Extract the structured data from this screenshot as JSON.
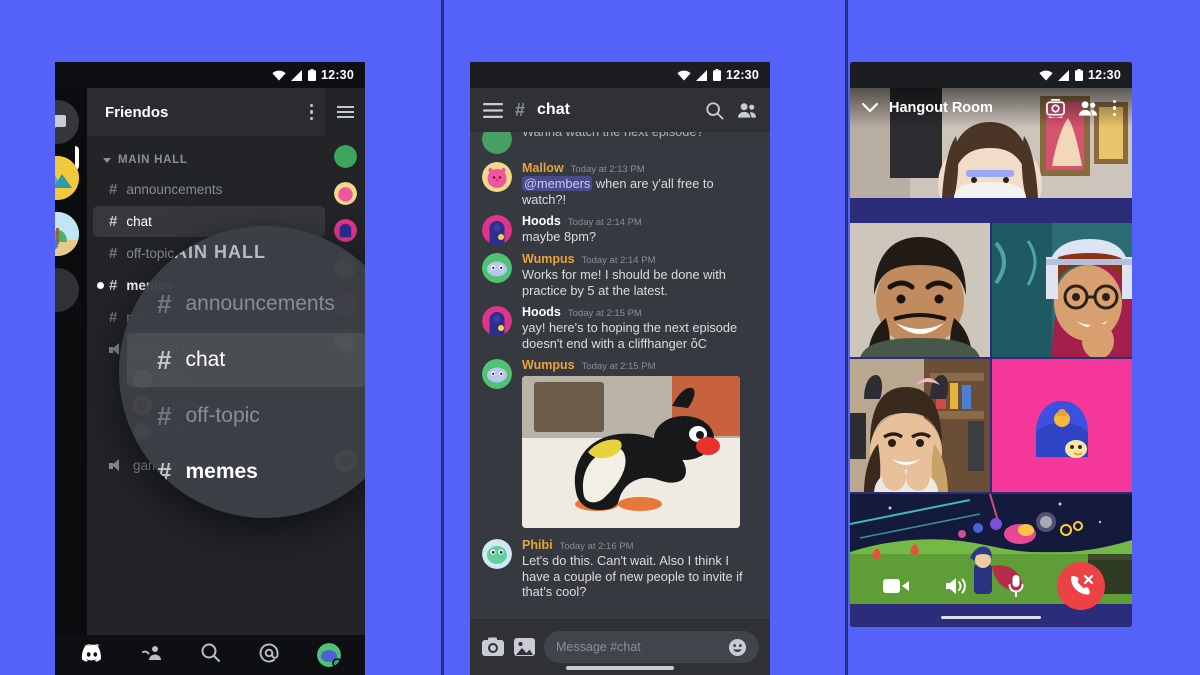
{
  "background_color": "#5562fa",
  "phone1": {
    "name": "discord-server-channels-screen",
    "statusbar": {
      "time": "12:30",
      "icons": [
        "wifi-icon",
        "signal-icon",
        "battery-icon"
      ]
    },
    "dm_button": "dm-bubble-icon",
    "server_name": "Friendos",
    "overflow": "kebab-menu-icon",
    "category": "MAIN HALL",
    "channels": [
      {
        "name": "announcements",
        "type": "text",
        "state": "read"
      },
      {
        "name": "chat",
        "type": "text",
        "state": "active"
      },
      {
        "name": "off-topic",
        "type": "text",
        "state": "read"
      },
      {
        "name": "memes",
        "type": "text",
        "state": "unread"
      },
      {
        "name": "music",
        "type": "text",
        "state": "read"
      },
      {
        "name": "general",
        "type": "voice",
        "state": "read"
      },
      {
        "name": "gaming",
        "type": "voice",
        "state": "read"
      }
    ],
    "voice_members": [
      "Phibi",
      "Mallow",
      "Wumpus"
    ],
    "tabs": [
      {
        "label": "Servers",
        "icon": "discord-logo-icon"
      },
      {
        "label": "Friends",
        "icon": "friends-icon"
      },
      {
        "label": "Search",
        "icon": "search-icon"
      },
      {
        "label": "Mentions",
        "icon": "at-mention-icon"
      },
      {
        "label": "Profile",
        "icon": "avatar-icon"
      }
    ]
  },
  "phone2": {
    "name": "discord-chat-screen",
    "statusbar": {
      "time": "12:30"
    },
    "menu_icon": "hamburger-menu-icon",
    "hash": "#",
    "channel": "chat",
    "search_icon": "search-icon",
    "members_icon": "members-icon",
    "messages": [
      {
        "author": "",
        "author_color": "#dcddde",
        "time": "",
        "text": "Wanna watch the next episode?",
        "cut_off": true,
        "avatar": "green"
      },
      {
        "author": "Mallow",
        "author_color": "#e8a33d",
        "time": "Today at 2:13 PM",
        "mention": "@members",
        "text": "when are y'all free to watch?!",
        "avatar": "pink"
      },
      {
        "author": "Hoods",
        "author_color": "#ffffff",
        "time": "Today at 2:14 PM",
        "text": "maybe 8pm?",
        "avatar": "magenta"
      },
      {
        "author": "Wumpus",
        "author_color": "#e8a33d",
        "time": "Today at 2:14 PM",
        "text": "Works for me! I should be done with practice by 5 at the latest.",
        "avatar": "green"
      },
      {
        "author": "Hoods",
        "author_color": "#ffffff",
        "time": "Today at 2:15 PM",
        "text": "yay! here's to hoping the next episode doesn't end with a cliffhanger ὄC",
        "avatar": "magenta"
      },
      {
        "author": "Wumpus",
        "author_color": "#e8a33d",
        "time": "Today at 2:15 PM",
        "text": "",
        "attachment": "pingu-penguin-gif",
        "avatar": "green"
      },
      {
        "author": "Phibi",
        "author_color": "#e8a33d",
        "time": "Today at 2:16 PM",
        "text": "Let's do this. Can't wait. Also I think I have a couple of new people to invite if that's cool?",
        "avatar": "teal"
      }
    ],
    "composer": {
      "camera_icon": "camera-icon",
      "gallery_icon": "image-icon",
      "placeholder": "Message #chat",
      "emoji_icon": "emoji-smiley-icon"
    }
  },
  "phone3": {
    "name": "discord-video-call-screen",
    "statusbar": {
      "time": "12:30"
    },
    "collapse_icon": "chevron-down-icon",
    "title": "Hangout Room",
    "switch_camera_icon": "switch-camera-icon",
    "members_icon": "members-icon",
    "overflow_icon": "kebab-menu-icon",
    "tiles": [
      {
        "kind": "video",
        "label": "participant-1"
      },
      {
        "kind": "video",
        "label": "participant-2"
      },
      {
        "kind": "video",
        "label": "participant-3"
      },
      {
        "kind": "video",
        "label": "participant-4"
      },
      {
        "kind": "avatar",
        "label": "participant-5-wumpus-avatar",
        "bg": "#f5379a"
      },
      {
        "kind": "screenshare",
        "label": "game-screen-share"
      }
    ],
    "controls": [
      {
        "icon": "video-camera-icon",
        "label": "Camera"
      },
      {
        "icon": "speaker-icon",
        "label": "Speaker"
      },
      {
        "icon": "microphone-icon",
        "label": "Mic"
      },
      {
        "icon": "hangup-icon",
        "label": "Leave call",
        "color": "#ed4245"
      }
    ]
  }
}
